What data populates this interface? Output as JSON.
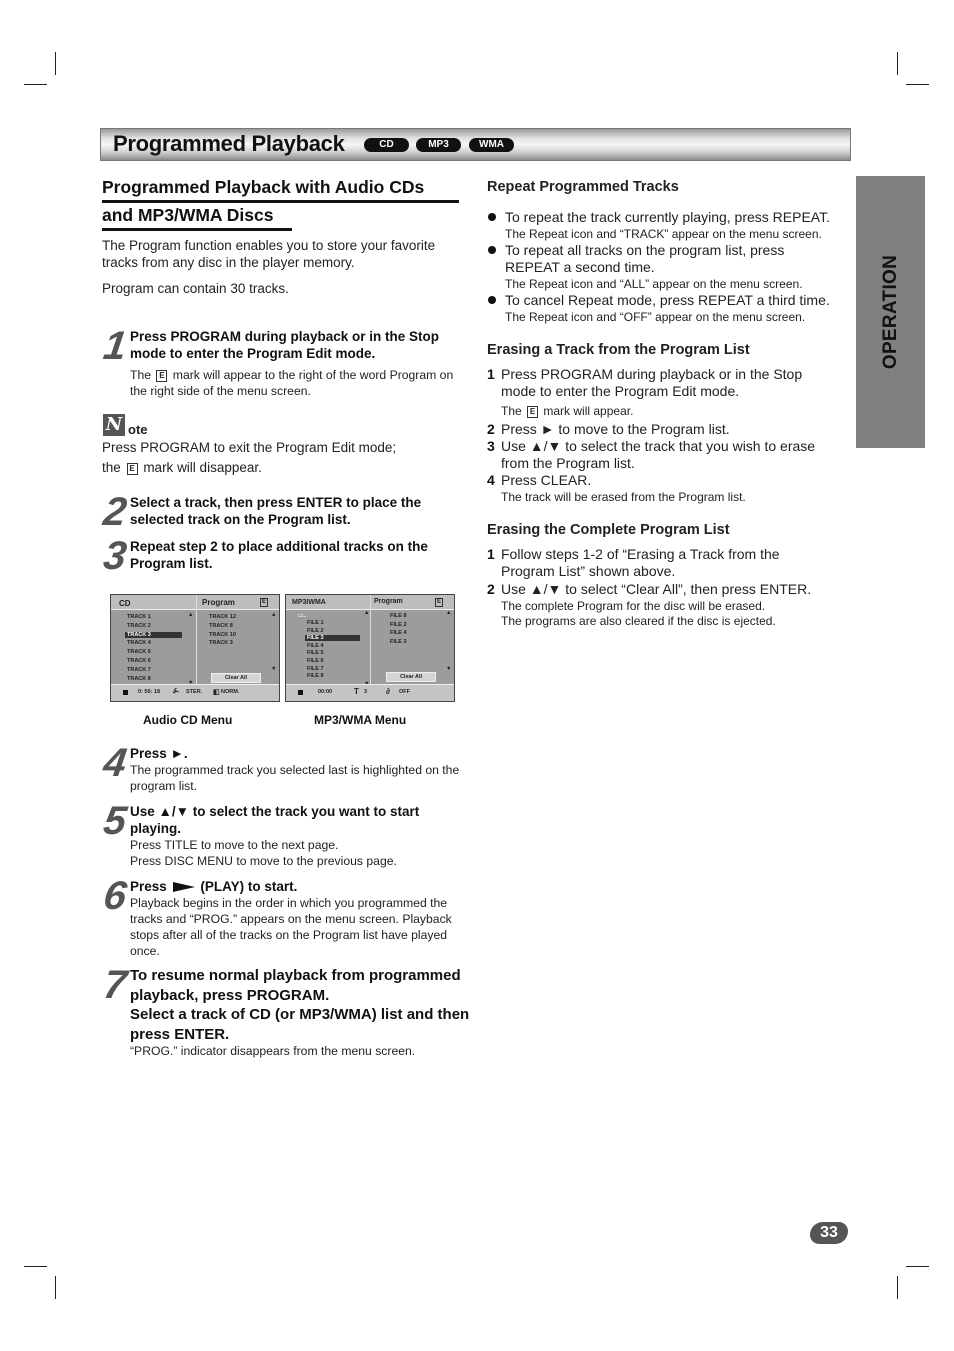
{
  "header": {
    "title": "Programmed Playback",
    "badges": [
      "CD",
      "MP3",
      "WMA"
    ]
  },
  "side_tab": "OPERATION",
  "left": {
    "heading_line1": "Programmed Playback with Audio CDs",
    "heading_line2": "and MP3/WMA Discs",
    "intro": "The Program function enables you to store your favorite tracks from any disc in the player memory.",
    "capacity": "Program can contain 30 tracks.",
    "step1": {
      "num": "1",
      "bold": "Press PROGRAM during playback or in the Stop mode to enter the Program Edit mode.",
      "sub_pre": "The",
      "sub_post": "mark will appear to the right of the word Program on the right side of the menu screen."
    },
    "note": {
      "icon_letter": "N",
      "title": "ote",
      "line1": "Press PROGRAM to exit the Program Edit mode;",
      "line2_pre": "the",
      "line2_post": "mark will disappear."
    },
    "step2": {
      "num": "2",
      "bold": "Select a track, then press ENTER to place the selected track on the Program list."
    },
    "step3": {
      "num": "3",
      "bold": "Repeat step 2 to place additional tracks on the Program list."
    },
    "step4": {
      "num": "4",
      "bold": "Press ►.",
      "sub": "The programmed track you selected last is highlighted on the program list."
    },
    "step5": {
      "num": "5",
      "bold": "Use ▲/▼ to select the track you want to start playing.",
      "sub1": "Press TITLE to move to the next page.",
      "sub2": "Press DISC MENU to move to the previous page."
    },
    "step6": {
      "num": "6",
      "bold_pre": "Press",
      "bold_post": "(PLAY) to start.",
      "sub": "Playback begins in the order in which you programmed the tracks and “PROG.” appears on the menu screen. Playback stops after all of the tracks on the Program list have played once."
    },
    "step7": {
      "num": "7",
      "bold1": "To resume normal playback from programmed playback, press PROGRAM.",
      "bold2": "Select a track of CD (or MP3/WMA) list and then press ENTER.",
      "sub": "“PROG.” indicator disappears from the menu screen."
    }
  },
  "cd_menu": {
    "left_title": "CD",
    "right_title": "Program",
    "edit_mark": "E",
    "tracks": [
      "TRACK 1",
      "TRACK 2",
      "TRACK 3",
      "TRACK 4",
      "TRACK 5",
      "TRACK 6",
      "TRACK 7",
      "TRACK 8"
    ],
    "selected_index": 2,
    "program": [
      "TRACK 12",
      "TRACK 8",
      "TRACK 10",
      "TRACK 3"
    ],
    "clear_all": "Clear All",
    "time": "0: 56: 18",
    "audio": "STER.",
    "sound": "NORM.",
    "caption": "Audio CD Menu"
  },
  "mp3_menu": {
    "left_title": "MP3IWMA",
    "right_title": "Program",
    "edit_mark": "E",
    "files": [
      "FILE 1",
      "FILE 2",
      "FILE 3",
      "FILE 4",
      "FILE 5",
      "FILE 6",
      "FILE 7",
      "FILE 8"
    ],
    "selected_index": 2,
    "program": [
      "FILE 8",
      "FILE 2",
      "FILE 4",
      "FILE 3"
    ],
    "clear_all": "Clear All",
    "time": "00:00",
    "track_count": "3",
    "repeat": "OFF",
    "caption": "MP3/WMA Menu"
  },
  "right": {
    "repeat_heading": "Repeat Programmed Tracks",
    "repeat_items": [
      {
        "main": "To repeat the track currently playing, press REPEAT.",
        "sub": "The Repeat icon and “TRACK” appear on the menu screen."
      },
      {
        "main": "To repeat all tracks on the program list, press REPEAT a second time.",
        "sub": "The Repeat icon and “ALL” appear on the menu screen."
      },
      {
        "main": "To cancel Repeat mode, press REPEAT a third time.",
        "sub": "The Repeat icon and “OFF” appear on the menu screen."
      }
    ],
    "erase_track_heading": "Erasing a Track from the Program List",
    "erase_track_steps": [
      {
        "num": "1",
        "text": "Press PROGRAM during playback or in the Stop mode to enter the Program Edit mode.",
        "sub_pre": "The",
        "sub_post": "mark will appear."
      },
      {
        "num": "2",
        "text": "Press ► to move to the Program list."
      },
      {
        "num": "3",
        "text": "Use ▲/▼ to select the track that you wish to erase from the Program list."
      },
      {
        "num": "4",
        "text": "Press CLEAR.",
        "sub": "The track will be erased from the Program list."
      }
    ],
    "erase_all_heading": "Erasing the Complete Program List",
    "erase_all_steps": [
      {
        "num": "1",
        "text": "Follow steps 1-2 of “Erasing a Track from the Program List” shown above."
      },
      {
        "num": "2",
        "text": "Use ▲/▼ to select “Clear All”, then press ENTER.",
        "sub1": "The complete Program for the disc will be erased.",
        "sub2": "The programs are also cleared if the disc is ejected."
      }
    ]
  },
  "page_number": "33"
}
